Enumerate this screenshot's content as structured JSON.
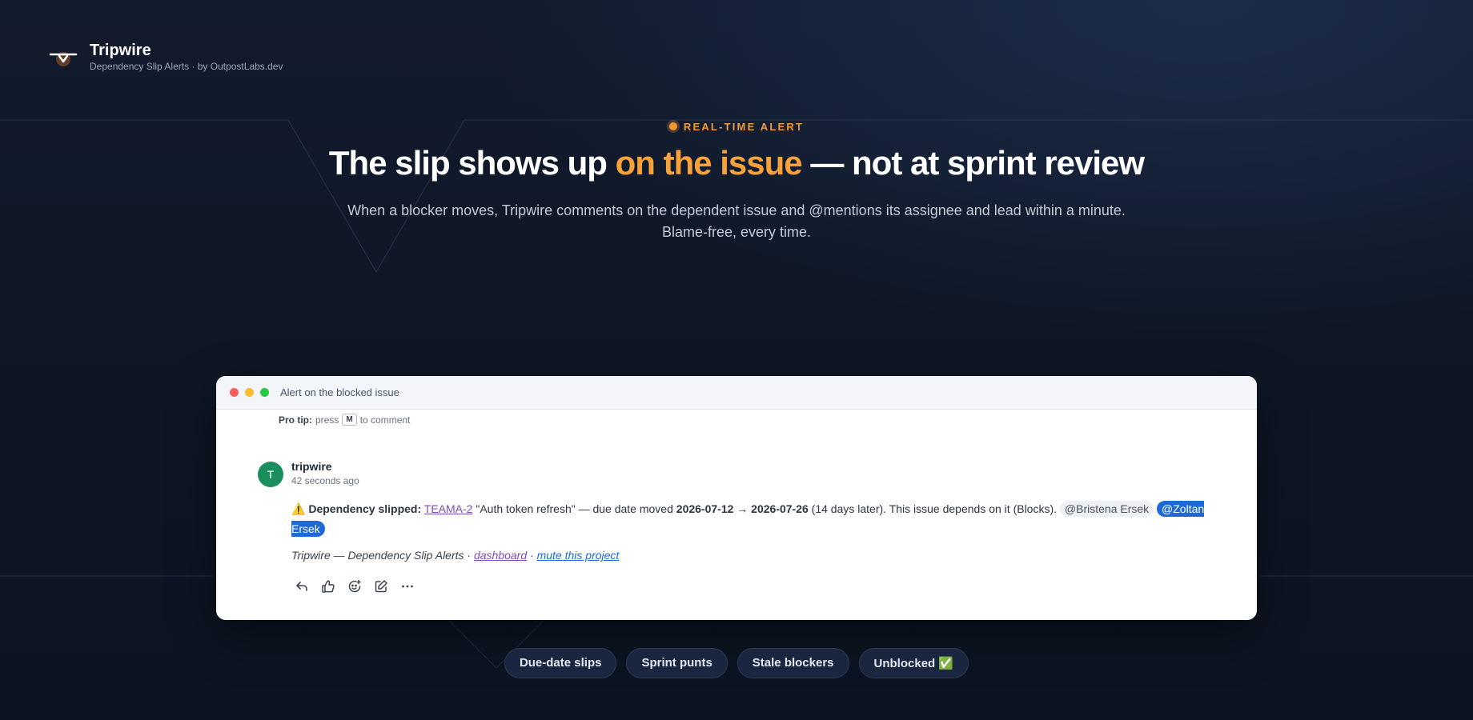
{
  "brand": {
    "name": "Tripwire",
    "tagline": "Dependency Slip Alerts · by OutpostLabs.dev"
  },
  "hero": {
    "eyebrow": "REAL-TIME ALERT",
    "headline_start": "The slip shows up ",
    "headline_accent": "on the issue",
    "headline_end": " — not at sprint review",
    "subtitle_line1": "When a blocker moves, Tripwire comments on the dependent issue and @mentions its assignee and lead within a minute.",
    "subtitle_line2": "Blame-free, every time."
  },
  "window": {
    "title": "Alert on the blocked issue",
    "protip": {
      "label": "Pro tip:",
      "pre": "press",
      "key": "M",
      "post": "to comment"
    },
    "comment": {
      "avatar_initial": "T",
      "author": "tripwire",
      "time": "42 seconds ago",
      "warning_emoji": "⚠️",
      "label": "Dependency slipped:",
      "issue_key": "TEAMA-2",
      "issue_title": " \"Auth token refresh\" — due date moved ",
      "date_change": "2026-07-12 → 2026-07-26",
      "detail": " (14 days later). This issue depends on it (Blocks). ",
      "mention_1": "@Bristena Ersek",
      "mention_2": "@Zoltan Ersek",
      "footer_text": "Tripwire — Dependency Slip Alerts · ",
      "footer_link_1": "dashboard",
      "footer_sep": " · ",
      "footer_link_2": "mute this project"
    },
    "actions": [
      "reply-icon",
      "thumbs-up-icon",
      "add-reaction-icon",
      "edit-icon",
      "more-icon"
    ]
  },
  "tags": [
    "Due-date slips",
    "Sprint punts",
    "Stale blockers",
    "Unblocked ✅"
  ],
  "colors": {
    "accent": "#f7a13a",
    "link_purple": "#7b4cc0",
    "mention_blue": "#1d6ad6",
    "avatar_green": "#1a8e5d"
  }
}
